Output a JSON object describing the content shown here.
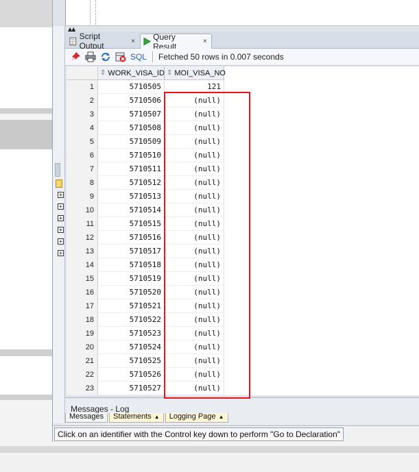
{
  "tabs": [
    {
      "label": "Script Output",
      "close": "×",
      "active": false
    },
    {
      "label": "Query Result",
      "close": "×",
      "active": true
    }
  ],
  "toolbar": {
    "icons": [
      "pin-icon",
      "print-icon",
      "refresh-icon",
      "cancel-query-icon"
    ],
    "sql_label": "SQL",
    "status": "Fetched 50 rows in 0.007 seconds"
  },
  "grid": {
    "columns": [
      "WORK_VISA_ID",
      "MOI_VISA_NO"
    ],
    "rows": [
      {
        "n": "1",
        "work_visa_id": "5710505",
        "moi_visa_no": "121"
      },
      {
        "n": "2",
        "work_visa_id": "5710506",
        "moi_visa_no": "(null)"
      },
      {
        "n": "3",
        "work_visa_id": "5710507",
        "moi_visa_no": "(null)"
      },
      {
        "n": "4",
        "work_visa_id": "5710508",
        "moi_visa_no": "(null)"
      },
      {
        "n": "5",
        "work_visa_id": "5710509",
        "moi_visa_no": "(null)"
      },
      {
        "n": "6",
        "work_visa_id": "5710510",
        "moi_visa_no": "(null)"
      },
      {
        "n": "7",
        "work_visa_id": "5710511",
        "moi_visa_no": "(null)"
      },
      {
        "n": "8",
        "work_visa_id": "5710512",
        "moi_visa_no": "(null)"
      },
      {
        "n": "9",
        "work_visa_id": "5710513",
        "moi_visa_no": "(null)"
      },
      {
        "n": "10",
        "work_visa_id": "5710514",
        "moi_visa_no": "(null)"
      },
      {
        "n": "11",
        "work_visa_id": "5710515",
        "moi_visa_no": "(null)"
      },
      {
        "n": "12",
        "work_visa_id": "5710516",
        "moi_visa_no": "(null)"
      },
      {
        "n": "13",
        "work_visa_id": "5710517",
        "moi_visa_no": "(null)"
      },
      {
        "n": "14",
        "work_visa_id": "5710518",
        "moi_visa_no": "(null)"
      },
      {
        "n": "15",
        "work_visa_id": "5710519",
        "moi_visa_no": "(null)"
      },
      {
        "n": "16",
        "work_visa_id": "5710520",
        "moi_visa_no": "(null)"
      },
      {
        "n": "17",
        "work_visa_id": "5710521",
        "moi_visa_no": "(null)"
      },
      {
        "n": "18",
        "work_visa_id": "5710522",
        "moi_visa_no": "(null)"
      },
      {
        "n": "19",
        "work_visa_id": "5710523",
        "moi_visa_no": "(null)"
      },
      {
        "n": "20",
        "work_visa_id": "5710524",
        "moi_visa_no": "(null)"
      },
      {
        "n": "21",
        "work_visa_id": "5710525",
        "moi_visa_no": "(null)"
      },
      {
        "n": "22",
        "work_visa_id": "5710526",
        "moi_visa_no": "(null)"
      },
      {
        "n": "23",
        "work_visa_id": "5710527",
        "moi_visa_no": "(null)"
      }
    ]
  },
  "log": {
    "title": "Messages - Log",
    "tabs": [
      "Messages",
      "Statements",
      "Logging Page"
    ]
  },
  "statusbar": {
    "text": "Click on an identifier with the Control key down to perform \"Go to Declaration\""
  },
  "colors": {
    "highlight": "#e8141c",
    "run_green": "#2fae3a",
    "sql_blue": "#2a5db0"
  }
}
